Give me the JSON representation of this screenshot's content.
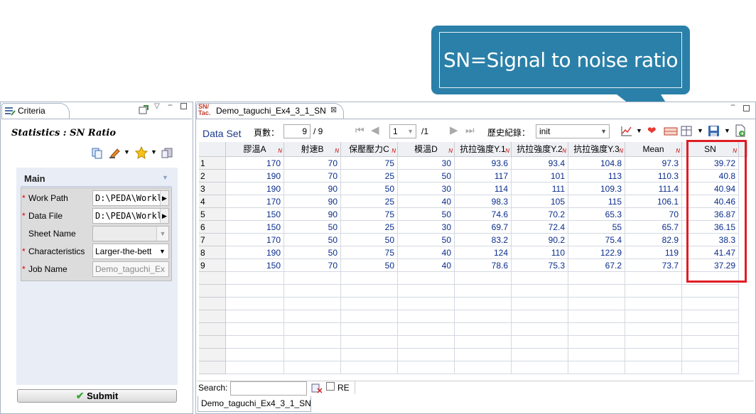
{
  "callout": {
    "text": "SN=Signal to noise ratio"
  },
  "left_panel": {
    "tab_title": "Criteria",
    "heading": "Statistics : SN Ratio",
    "section_title": "Main",
    "fields": [
      {
        "label": "Work Path",
        "value": "D:\\PEDA\\Workl",
        "required": true
      },
      {
        "label": "Data File",
        "value": "D:\\PEDA\\Workl",
        "required": true
      },
      {
        "label": "Sheet Name",
        "value": "",
        "required": false
      },
      {
        "label": "Characteristics",
        "value": "Larger-the-bett",
        "required": true
      },
      {
        "label": "Job Name",
        "value": "Demo_taguchi_Ex",
        "required": true
      }
    ],
    "submit_label": "Submit"
  },
  "right_panel": {
    "tab_title": "Demo_taguchi_Ex4_3_1_SN",
    "tab_badge": "SN/ Tac.",
    "toolbar": {
      "data_set_label": "Data Set",
      "pages_label": "頁數：",
      "page_value": "9",
      "page_total": "/ 9",
      "page_select": "1",
      "page_select_total": "/1",
      "history_label": "歷史紀錄：",
      "history_value": "init"
    },
    "table": {
      "columns": [
        "膠溫A",
        "射速B",
        "保壓壓力C",
        "模溫D",
        "抗拉強度Y.1",
        "抗拉強度Y.2",
        "抗拉強度Y.3",
        "Mean",
        "SN"
      ],
      "column_marker": "N",
      "rows": [
        [
          "1",
          "170",
          "70",
          "75",
          "30",
          "93.6",
          "93.4",
          "104.8",
          "97.3",
          "39.72"
        ],
        [
          "2",
          "190",
          "70",
          "25",
          "50",
          "117",
          "101",
          "113",
          "110.3",
          "40.8"
        ],
        [
          "3",
          "190",
          "90",
          "50",
          "30",
          "114",
          "111",
          "109.3",
          "111.4",
          "40.94"
        ],
        [
          "4",
          "170",
          "90",
          "25",
          "40",
          "98.3",
          "105",
          "115",
          "106.1",
          "40.46"
        ],
        [
          "5",
          "150",
          "90",
          "75",
          "50",
          "74.6",
          "70.2",
          "65.3",
          "70",
          "36.87"
        ],
        [
          "6",
          "150",
          "50",
          "25",
          "30",
          "69.7",
          "72.4",
          "55",
          "65.7",
          "36.15"
        ],
        [
          "7",
          "170",
          "50",
          "50",
          "50",
          "83.2",
          "90.2",
          "75.4",
          "82.9",
          "38.3"
        ],
        [
          "8",
          "190",
          "50",
          "75",
          "40",
          "124",
          "110",
          "122.9",
          "119",
          "41.47"
        ],
        [
          "9",
          "150",
          "70",
          "50",
          "40",
          "78.6",
          "75.3",
          "67.2",
          "73.7",
          "37.29"
        ]
      ]
    },
    "search": {
      "label": "Search:",
      "value": "",
      "re_label": "RE"
    },
    "bottom_tab": "Demo_taguchi_Ex4_3_1_SN"
  },
  "colors": {
    "callout": "#2a80a8",
    "highlight": "#e01c24",
    "cell_text": "#0a2d8c"
  }
}
